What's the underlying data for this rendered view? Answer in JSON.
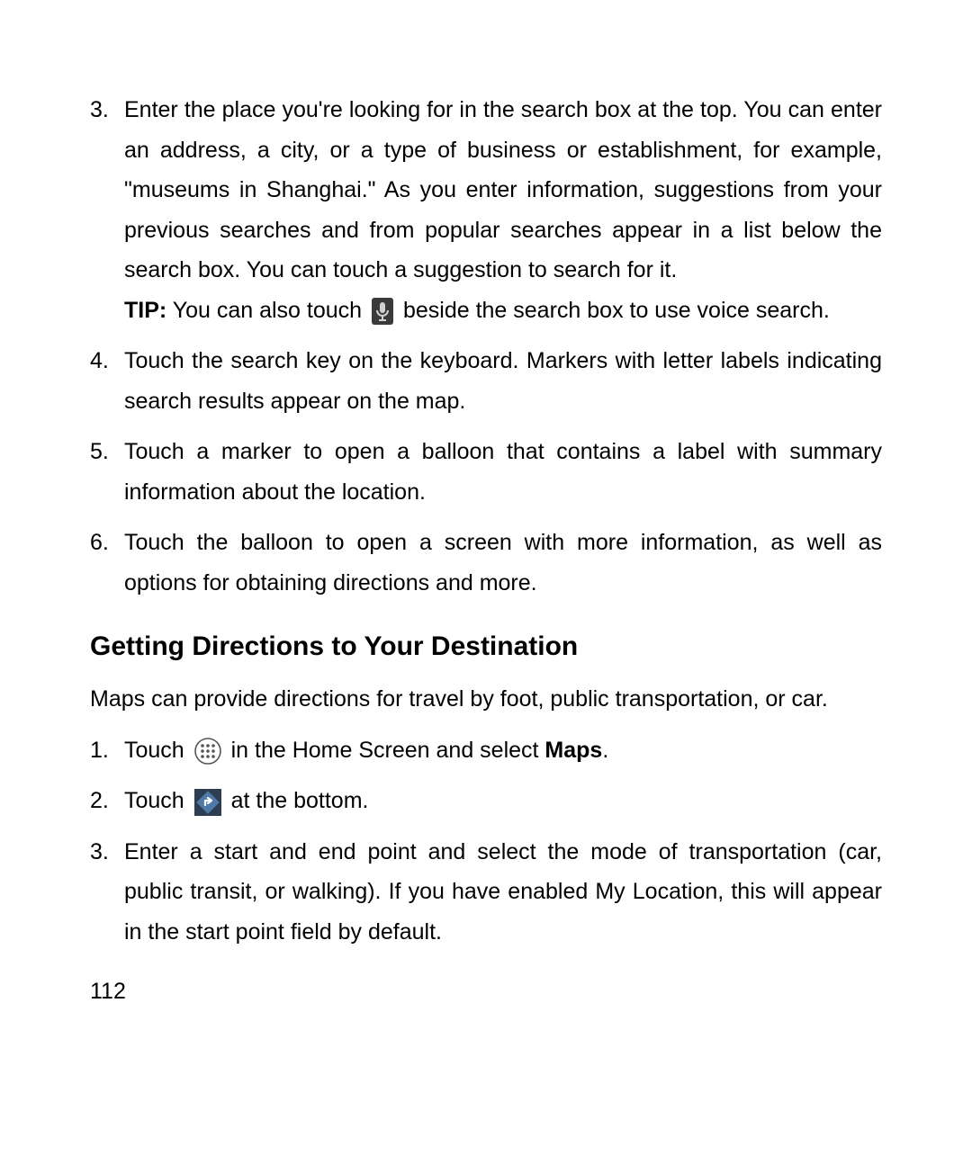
{
  "section1": {
    "items": [
      {
        "n": "3.",
        "text_a": "Enter the place you're looking for in the search box at the top. You can enter an address, a city, or a type of business or establishment, for example, \"museums in Shanghai.\" As you enter information, suggestions from your previous searches and from popular searches appear in a list below the search box. You can touch a suggestion to search for it.",
        "tip_label": "TIP:",
        "tip_before": " You can also touch ",
        "tip_after": " beside the search box to use voice search."
      },
      {
        "n": "4.",
        "text": "Touch the search key on the keyboard. Markers with letter labels indicating search results appear on the map."
      },
      {
        "n": "5.",
        "text": "Touch a marker to open a balloon that contains a label with summary information about the location."
      },
      {
        "n": "6.",
        "text": "Touch the balloon to open a screen with more information, as well as options for obtaining directions and more."
      }
    ]
  },
  "heading": "Getting Directions to Your Destination",
  "intro": "Maps can provide directions for travel by foot, public transportation, or car.",
  "section2": {
    "items": [
      {
        "n": "1.",
        "before": "Touch ",
        "after1": " in the Home Screen and select ",
        "bold": "Maps",
        "after2": "."
      },
      {
        "n": "2.",
        "before": "Touch ",
        "after": " at the bottom."
      },
      {
        "n": "3.",
        "text": "Enter a start and end point and select the mode of transportation (car, public transit, or walking). If you have enabled My Location, this will appear in the start point field by default."
      }
    ]
  },
  "page_number": "112"
}
